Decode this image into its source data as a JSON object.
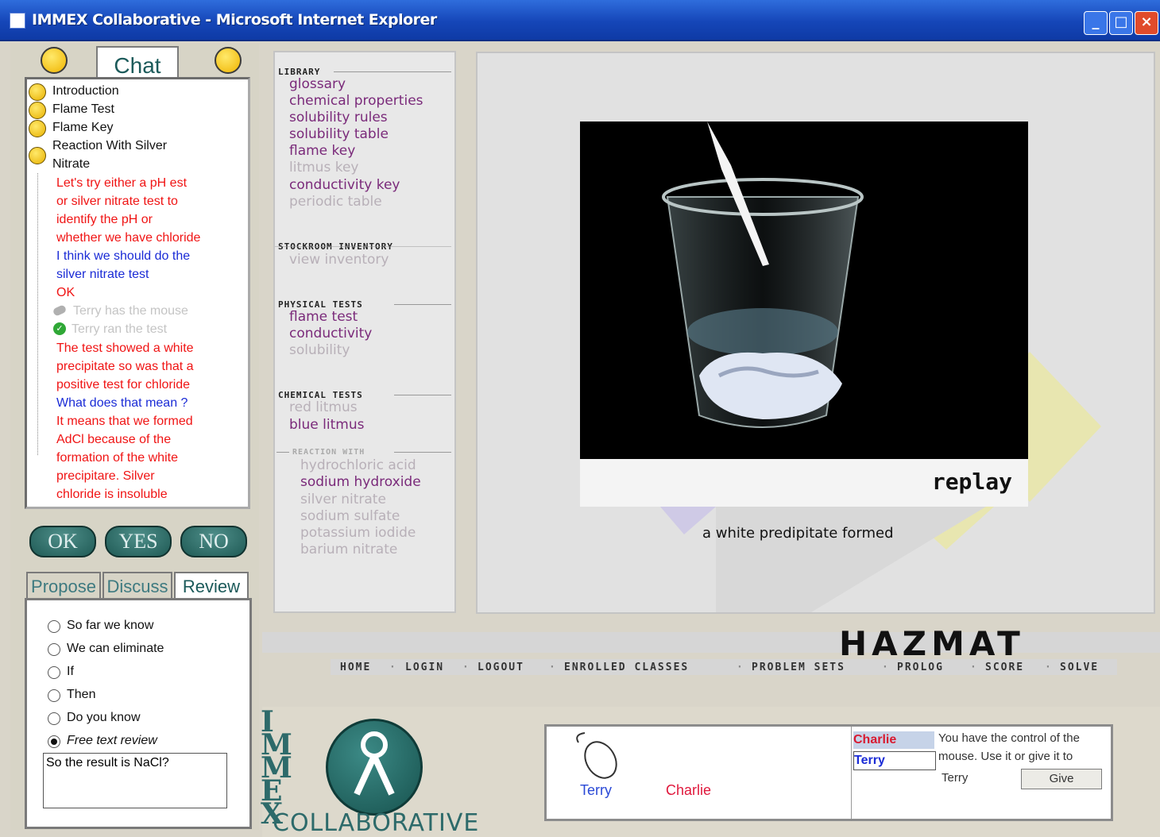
{
  "window": {
    "title": "IMMEX Collaborative - Microsoft Internet Explorer"
  },
  "chat": {
    "tab_label": "Chat",
    "tree": [
      "Introduction",
      "Flame Test",
      "Flame Key",
      "Reaction With Silver",
      "Nitrate"
    ],
    "messages": [
      {
        "text": "Let's try either a pH est",
        "style": "red"
      },
      {
        "text": "or silver nitrate test to",
        "style": "red"
      },
      {
        "text": "identify the pH or",
        "style": "red"
      },
      {
        "text": "whether we have chloride",
        "style": "red"
      },
      {
        "text": "I think we should do the",
        "style": "blue"
      },
      {
        "text": "silver nitrate test",
        "style": "blue"
      },
      {
        "text": "OK",
        "style": "red"
      },
      {
        "text": "Terry has the mouse",
        "style": "grey"
      },
      {
        "text": "Terry ran the test",
        "style": "grey"
      },
      {
        "text": "The test showed a white",
        "style": "red"
      },
      {
        "text": "precipitate so was that a",
        "style": "red"
      },
      {
        "text": "positive test for chloride",
        "style": "red"
      },
      {
        "text": "What does that mean ?",
        "style": "blue"
      },
      {
        "text": "It means that we formed",
        "style": "red"
      },
      {
        "text": "AdCl because of the",
        "style": "red"
      },
      {
        "text": "formation of the white",
        "style": "red"
      },
      {
        "text": "precipitare. Silver",
        "style": "red"
      },
      {
        "text": "chloride is insoluble",
        "style": "red"
      }
    ]
  },
  "quick_buttons": [
    "OK",
    "YES",
    "NO"
  ],
  "mode_tabs": [
    "Propose",
    "Discuss",
    "Review"
  ],
  "review": {
    "options": [
      "So far we know",
      "We can eliminate",
      "If",
      "Then",
      "Do you know",
      "Free text review"
    ],
    "selected": "Free text review",
    "text": "So the result is NaCl?"
  },
  "library": {
    "sections": {
      "library": "LIBRARY",
      "stockroom": "STOCKROOM INVENTORY",
      "physical": "PHYSICAL TESTS",
      "chemical": "CHEMICAL TESTS",
      "reaction": "REACTION WITH"
    },
    "library_items": [
      "glossary",
      "chemical properties",
      "solubility rules",
      "solubility table",
      "flame key",
      "litmus key",
      "conductivity key",
      "periodic table"
    ],
    "stockroom_items": [
      "view inventory"
    ],
    "physical_items": [
      "flame test",
      "conductivity",
      "solubility"
    ],
    "chemical_items": [
      "red litmus",
      "blue litmus"
    ],
    "reaction_items": [
      "hydrochloric acid",
      "sodium hydroxide",
      "silver nitrate",
      "sodium sulfate",
      "potassium iodide",
      "barium nitrate"
    ]
  },
  "simulation": {
    "replay_label": "replay",
    "caption": "a white predipitate formed"
  },
  "brand": {
    "hazmat": "HAZMAT",
    "immex_vertical": "IMMEX",
    "collaborative": "COLLABORATIVE"
  },
  "nav": [
    "HOME",
    "LOGIN",
    "LOGOUT",
    "ENROLLED CLASSES",
    "PROBLEM SETS",
    "PROLOG",
    "SCORE",
    "SOLVE"
  ],
  "mouse_control": {
    "user1": "Terry",
    "user2": "Charlie",
    "list": [
      "Charlie",
      "Terry"
    ],
    "message_line1": "You have the control of the",
    "message_line2": "mouse. Use it or give it to",
    "target": "Terry",
    "give_label": "Give"
  },
  "colors": {
    "title_bar": "#1546b8",
    "chat_red": "#f01414",
    "chat_blue": "#1a2bd6",
    "teal": "#1f5a55"
  }
}
